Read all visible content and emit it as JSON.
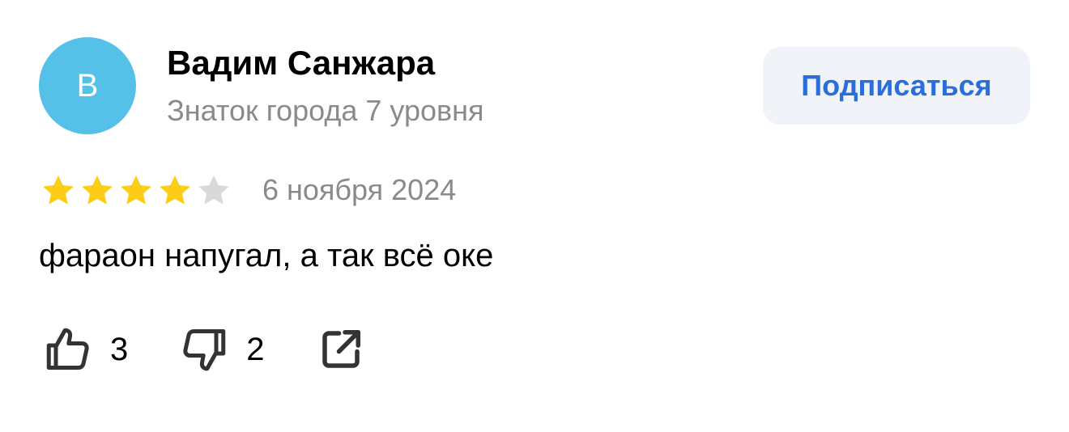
{
  "author": {
    "avatar_letter": "В",
    "avatar_color": "#55c1e8",
    "name": "Вадим Санжара",
    "level": "Знаток города 7 уровня"
  },
  "subscribe": {
    "label": "Подписаться",
    "text_color": "#2b6ddb",
    "background": "#f0f4f9"
  },
  "review": {
    "rating": 4,
    "max_rating": 5,
    "star_filled_color": "#fccc16",
    "star_empty_color": "#d9d9d9",
    "date": "6 ноября 2024",
    "text": "фараон напугал, а так всё оке"
  },
  "actions": {
    "likes": "3",
    "dislikes": "2",
    "like_icon": "thumbs-up-icon",
    "dislike_icon": "thumbs-down-icon",
    "share_icon": "share-external-icon"
  }
}
